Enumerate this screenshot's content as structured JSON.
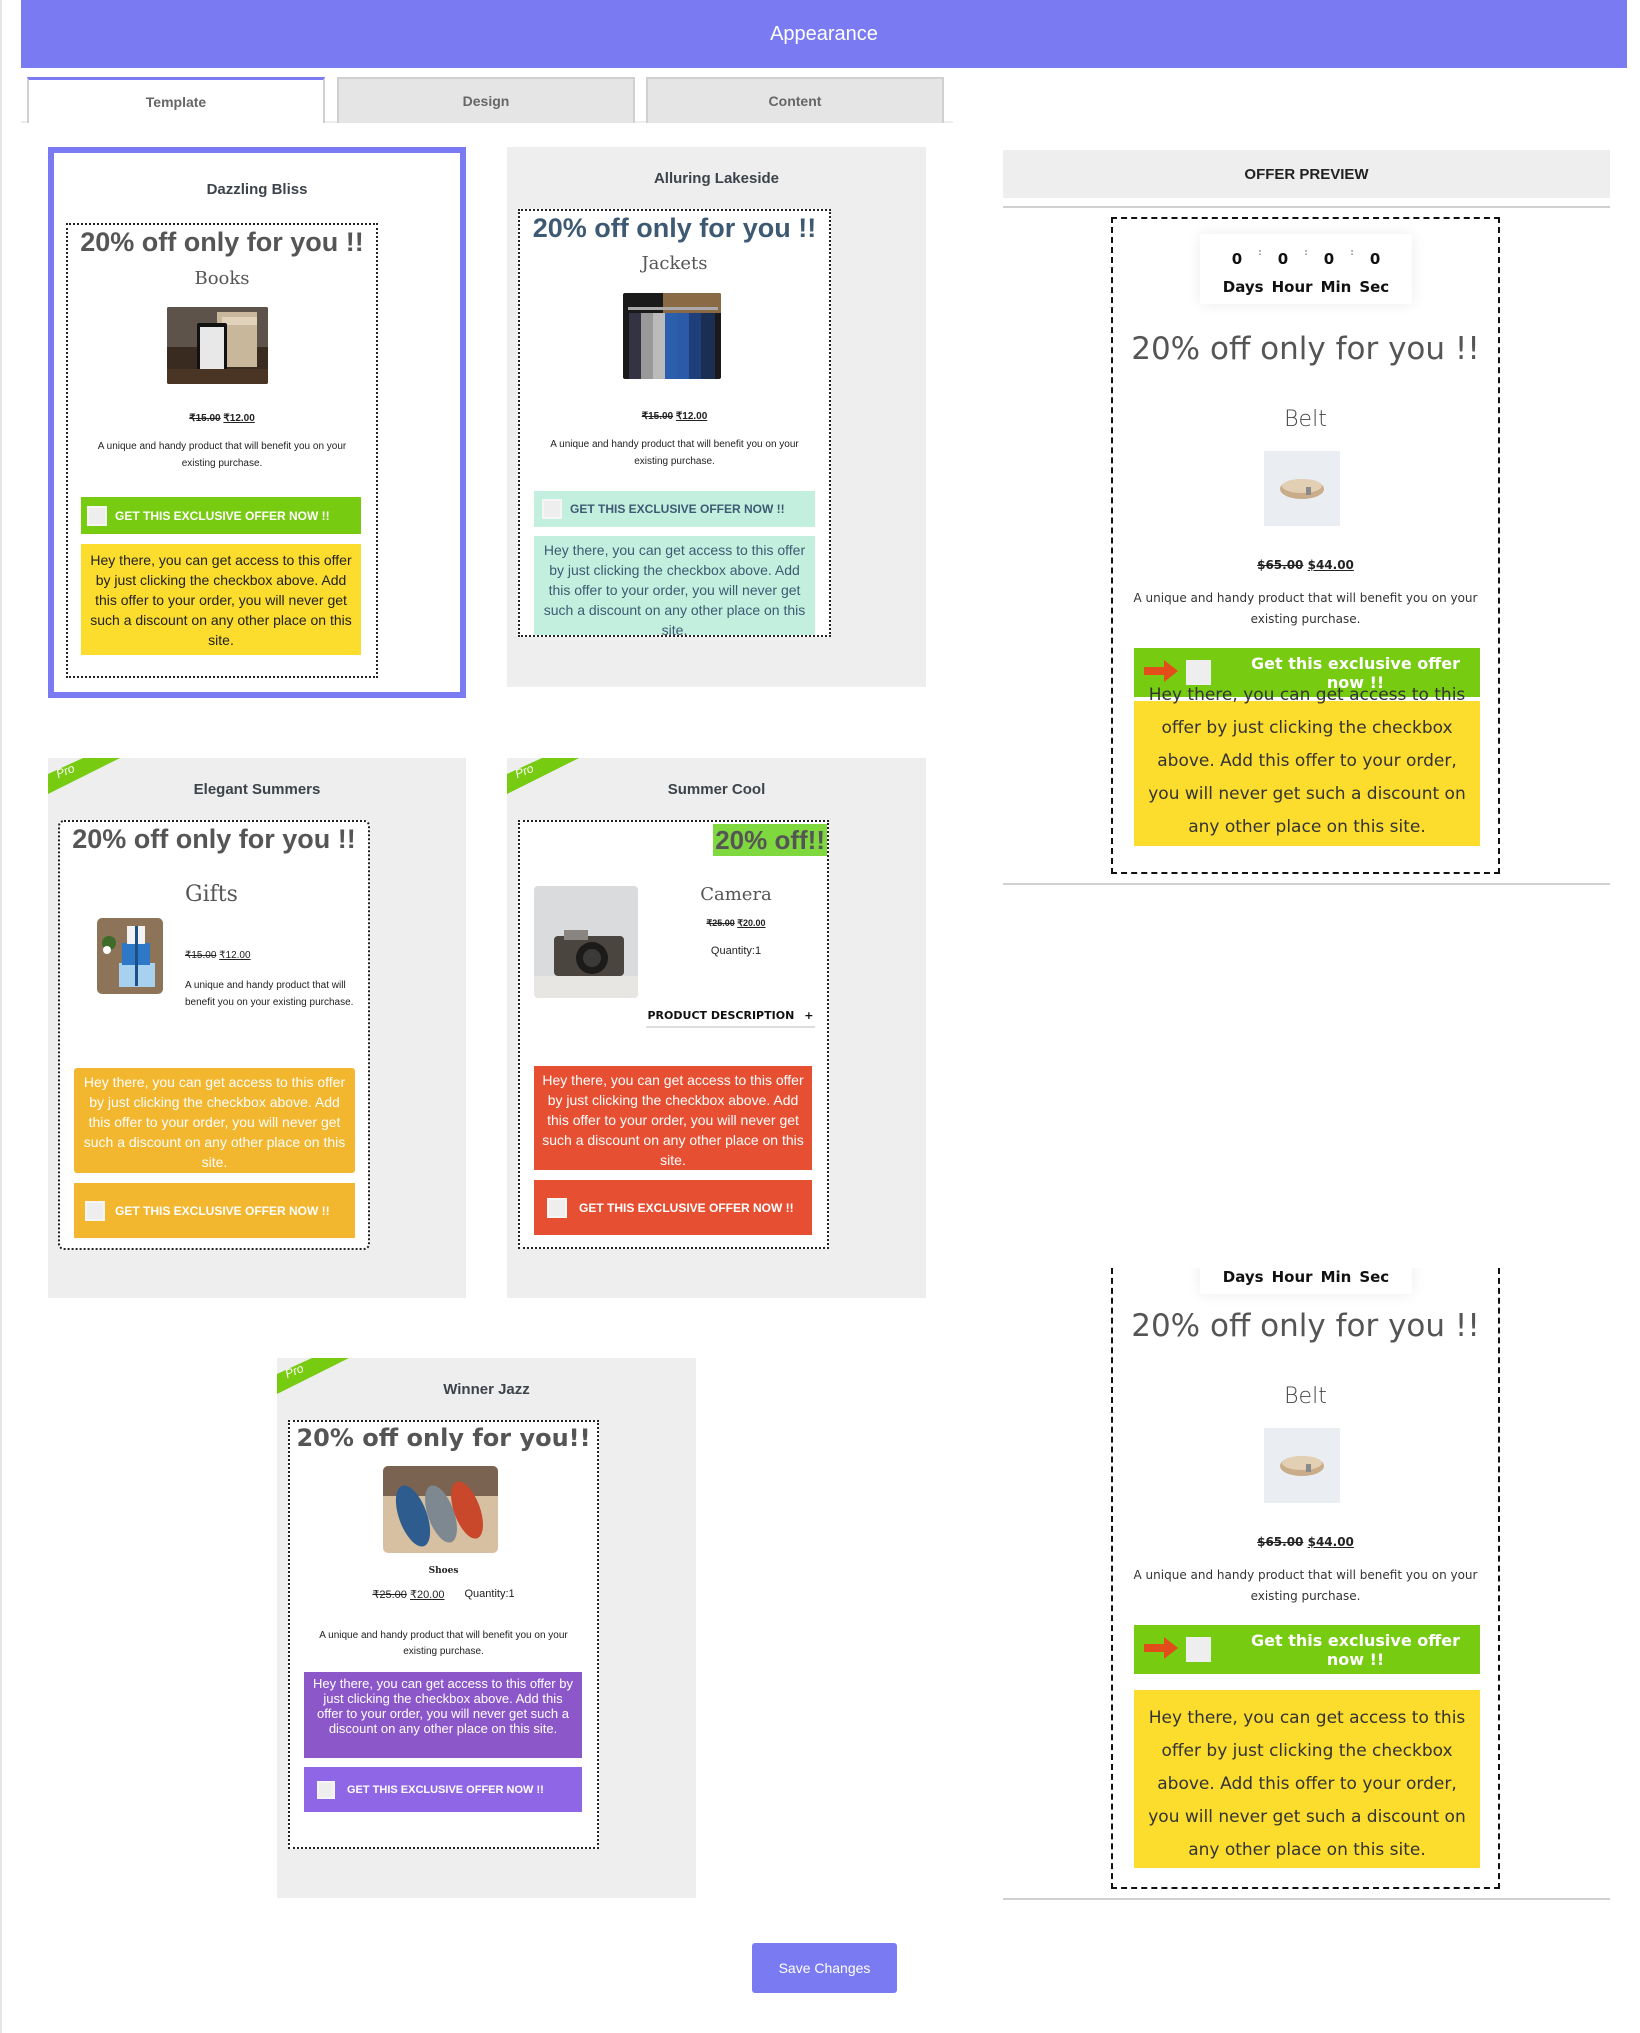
{
  "header": {
    "title": "Appearance"
  },
  "tabs": [
    {
      "label": "Template",
      "active": true
    },
    {
      "label": "Design",
      "active": false
    },
    {
      "label": "Content",
      "active": false
    }
  ],
  "common": {
    "description": "A unique and handy product that will benefit you on your existing purchase.",
    "cta_label": "GET THIS EXCLUSIVE OFFER NOW !!",
    "message": "Hey there, you can get access to this offer by just clicking the checkbox above. Add this offer to your order, you will never get such a discount on any other place on this site.",
    "pro_badge": "Pro"
  },
  "templates": [
    {
      "name": "Dazzling Bliss",
      "selected": true,
      "pro": false,
      "headline": "20% off only for you !!",
      "product": "Books",
      "old_price": "₹15.00",
      "new_price": "₹12.00",
      "cta_color": "#77cc11",
      "msg_color": "#fcdc2c",
      "msg_text_color": "#222222"
    },
    {
      "name": "Alluring Lakeside",
      "selected": false,
      "pro": false,
      "headline": "20% off only for you !!",
      "product": "Jackets",
      "old_price": "₹15.00",
      "new_price": "₹12.00",
      "cta_color": "#c3f0de",
      "msg_color": "#c3f0de",
      "msg_text_color": "#3e5a73"
    },
    {
      "name": "Elegant Summers",
      "selected": false,
      "pro": true,
      "headline": "20% off only for you !!",
      "product": "Gifts",
      "old_price": "₹15.00",
      "new_price": "₹12.00",
      "cta_color": "#f3b62f",
      "msg_color": "#f3b62f",
      "msg_text_color": "#ffffff"
    },
    {
      "name": "Summer Cool",
      "selected": false,
      "pro": true,
      "headline": "20% off!!",
      "product": "Camera",
      "old_price": "₹25.00",
      "new_price": "₹20.00",
      "quantity": "Quantity:1",
      "accordion": "PRODUCT DESCRIPTION",
      "accordion_icon": "plus-icon",
      "cta_color": "#e74f33",
      "msg_color": "#e74f33",
      "msg_text_color": "#ffffff"
    },
    {
      "name": "Winner Jazz",
      "selected": false,
      "pro": true,
      "headline": "20% off only for you!!",
      "product": "Shoes",
      "old_price": "₹25.00",
      "new_price": "₹20.00",
      "quantity": "Quantity:1",
      "cta_color": "#8f66e6",
      "msg_color": "#8c58c9",
      "msg_text_color": "#ffffff"
    }
  ],
  "preview": {
    "title": "OFFER PREVIEW",
    "countdown": {
      "days": "0",
      "hours": "0",
      "minutes": "0",
      "seconds": "0",
      "labels": [
        "Days",
        "Hour",
        "Min",
        "Sec"
      ],
      "separator": ":"
    },
    "headline": "20% off only for you !!",
    "product": "Belt",
    "old_price": "$65.00",
    "new_price": "$44.00",
    "description": "A unique and handy product that will benefit you on your existing purchase.",
    "cta_label": "Get this exclusive offer now !!",
    "cta_icon": "arrow-right-icon",
    "message": "Hey there, you can get access to this offer by just clicking the checkbox above. Add this offer to your order, you will never get such a discount on any other place on this site.",
    "colors": {
      "cta": "#77cc11",
      "message": "#fcdc2c",
      "arrow": "#e34d1a"
    }
  },
  "footer": {
    "save_label": "Save Changes"
  },
  "colors": {
    "accent": "#7a7af3",
    "pro_ribbon": "#77cc11"
  }
}
